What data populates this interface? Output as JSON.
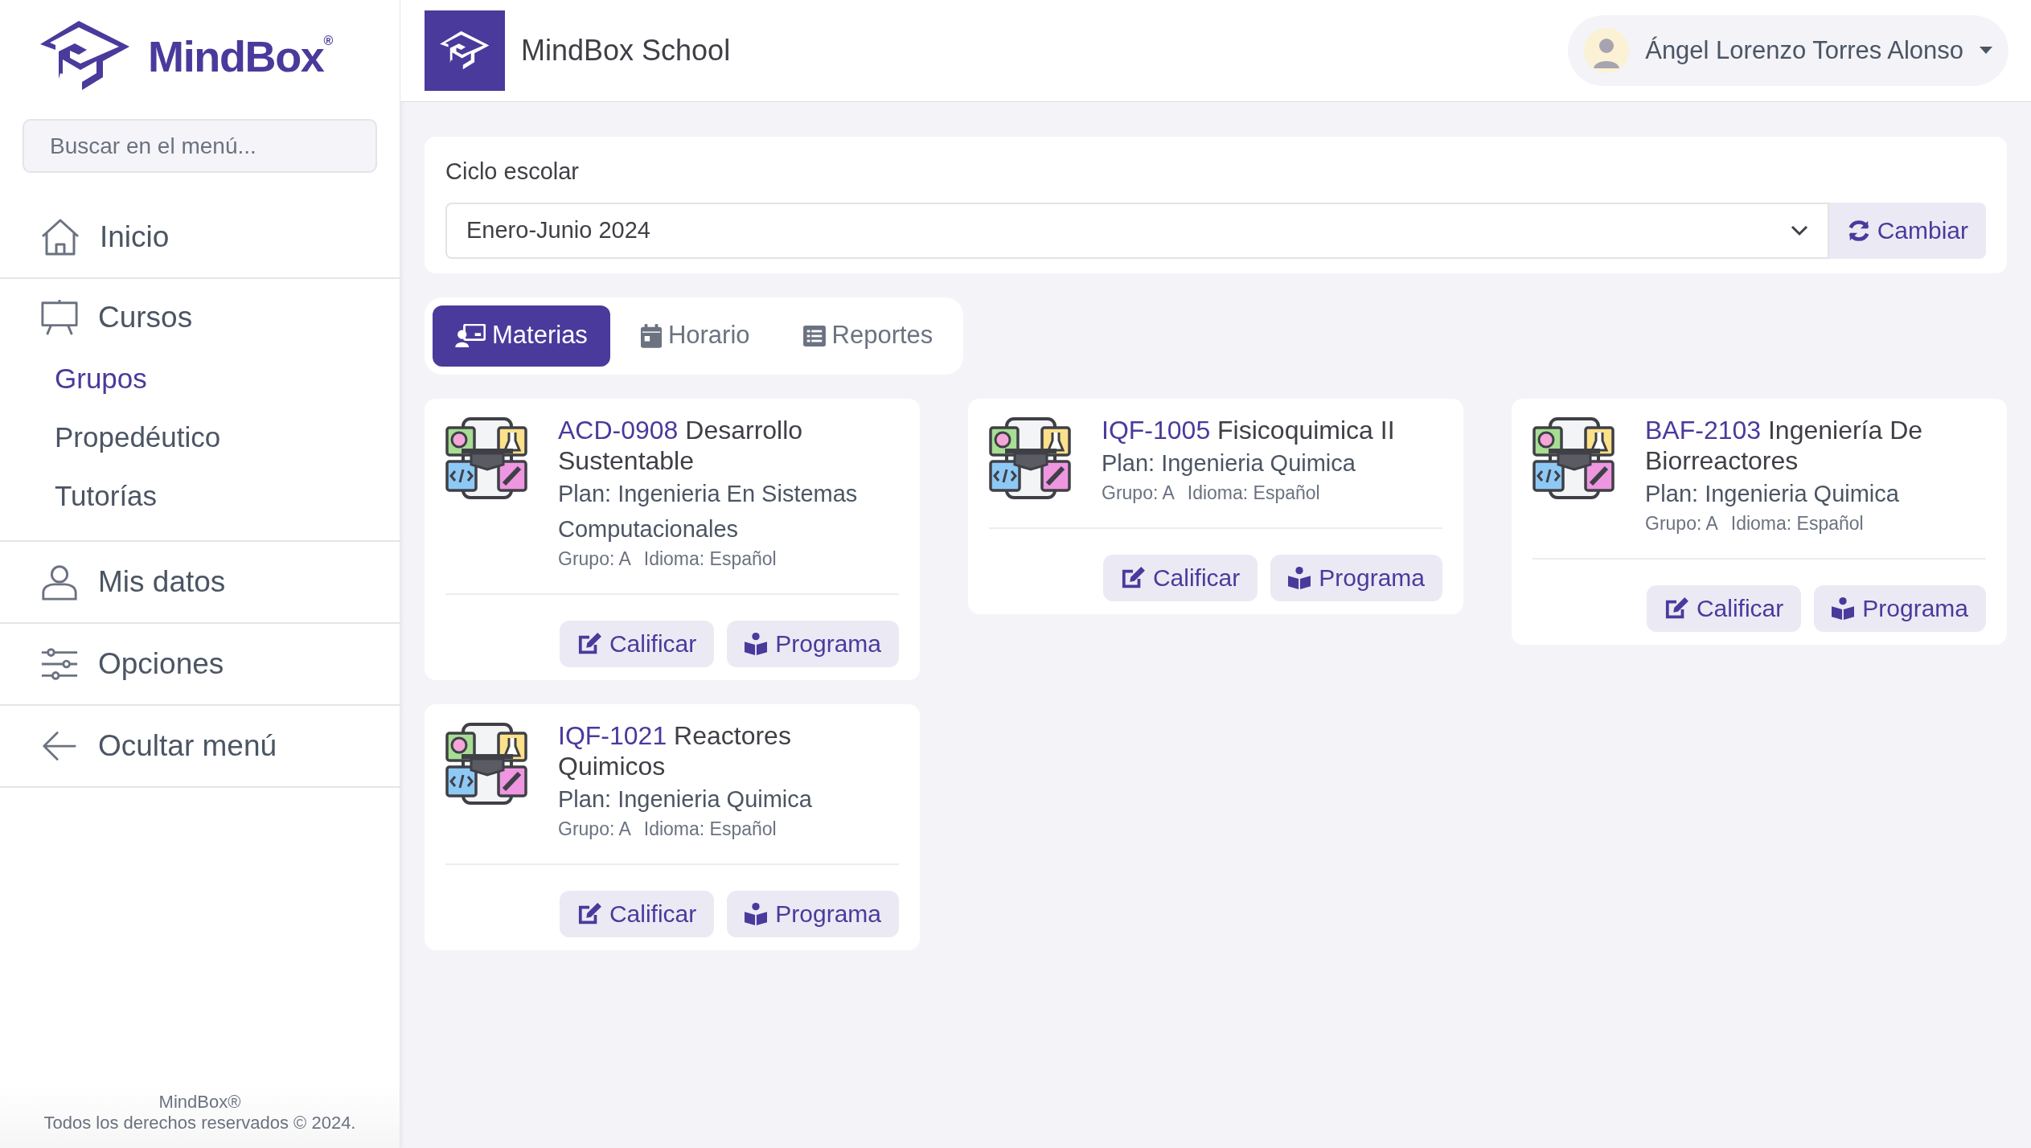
{
  "sidebar": {
    "brand": "MindBox",
    "brand_mark": "®",
    "search": {
      "placeholder": "Buscar en el menú..."
    },
    "items": [
      {
        "label": "Inicio",
        "selected": false
      },
      {
        "label": "Cursos",
        "selected": false,
        "children": [
          {
            "label": "Grupos",
            "selected": true
          },
          {
            "label": "Propedéutico",
            "selected": false
          },
          {
            "label": "Tutorías",
            "selected": false
          }
        ]
      },
      {
        "label": "Mis datos",
        "selected": false
      },
      {
        "label": "Opciones",
        "selected": false
      },
      {
        "label": "Ocultar menú",
        "selected": false
      }
    ],
    "footer": [
      "MindBox®",
      "Todos los derechos reservados © 2024."
    ]
  },
  "header": {
    "title": "MindBox School",
    "user": "Ángel Lorenzo Torres Alonso"
  },
  "cycle": {
    "label": "Ciclo escolar",
    "value": "Enero-Junio 2024",
    "button": "Cambiar"
  },
  "tabs": [
    {
      "label": "Materias",
      "selected": true
    },
    {
      "label": "Horario",
      "selected": false
    },
    {
      "label": "Reportes",
      "selected": false
    }
  ],
  "courses": [
    {
      "code": "ACD-0908",
      "name": "Desarrollo Sustentable",
      "plan": "Plan: Ingenieria En Sistemas Computacionales",
      "group": "Grupo: A",
      "language": "Idioma: Español",
      "buttons": [
        "Calificar",
        "Programa"
      ]
    },
    {
      "code": "IQF-1005",
      "name": "Fisicoquimica II",
      "plan": "Plan: Ingenieria Quimica",
      "group": "Grupo: A",
      "language": "Idioma: Español",
      "buttons": [
        "Calificar",
        "Programa"
      ]
    },
    {
      "code": "BAF-2103",
      "name": "Ingeniería De Biorreactores",
      "plan": "Plan: Ingenieria Quimica",
      "group": "Grupo: A",
      "language": "Idioma: Español",
      "buttons": [
        "Calificar",
        "Programa"
      ]
    },
    {
      "code": "IQF-1021",
      "name": "Reactores Quimicos",
      "plan": "Plan: Ingenieria Quimica",
      "group": "Grupo: A",
      "language": "Idioma: Español",
      "buttons": [
        "Calificar",
        "Programa"
      ]
    }
  ]
}
